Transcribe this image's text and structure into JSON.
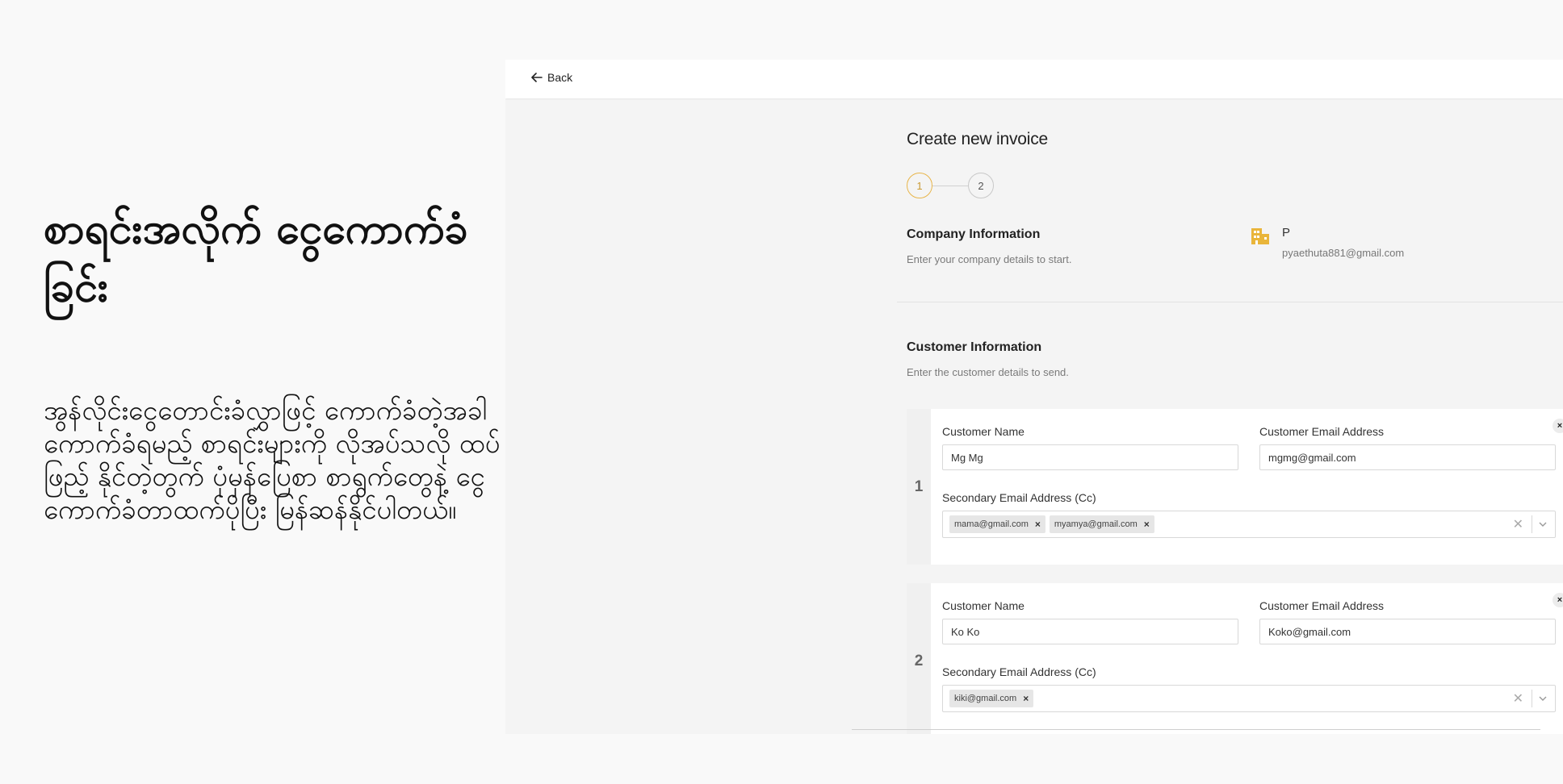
{
  "hero": {
    "title": "စာရင်းအလိုက် ငွေကောက်ခံခြင်း",
    "body": "အွန်လိုင်းငွေတောင်းခံလွှာဖြင့် ကောက်ခံတဲ့အခါ ကောက်ခံရမည့် စာရင်းများကို လိုအပ်သလို ထပ်ဖြည့် နိုင်တဲ့တွက် ပုံမှန်ပြေစာ စာရွက်တွေနဲ့ ငွေကောက်ခံတာထက်ပိုပြီး မြန်ဆန်နိုင်ပါတယ်။"
  },
  "topbar": {
    "back_label": "Back"
  },
  "page": {
    "title": "Create new invoice",
    "steps": [
      "1",
      "2"
    ]
  },
  "company": {
    "section_title": "Company Information",
    "section_sub": "Enter your company details to start.",
    "name": "P",
    "email": "pyaethuta881@gmail.com"
  },
  "customers_section": {
    "title": "Customer Information",
    "sub": "Enter the customer details to send."
  },
  "labels": {
    "customer_name": "Customer Name",
    "customer_email": "Customer Email Address",
    "secondary_email": "Secondary Email Address (Cc)"
  },
  "customers": [
    {
      "number": "1",
      "name": "Mg Mg",
      "email": "mgmg@gmail.com",
      "cc": [
        "mama@gmail.com",
        "myamya@gmail.com"
      ]
    },
    {
      "number": "2",
      "name": "Ko Ko",
      "email": "Koko@gmail.com",
      "cc": [
        "kiki@gmail.com"
      ]
    }
  ],
  "colors": {
    "accent": "#e8b54a",
    "building_icon": "#e9b53a"
  },
  "icons": {
    "remove": "×",
    "clear": "✕"
  }
}
